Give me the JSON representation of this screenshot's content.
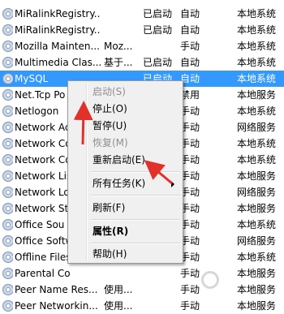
{
  "services": [
    {
      "name": "MiRalinkRegistry...",
      "desc": "",
      "status": "已启动",
      "startup": "自动",
      "logon": "本地系统"
    },
    {
      "name": "MiRalinkRegistry...",
      "desc": "",
      "status": "已启动",
      "startup": "自动",
      "logon": "本地系统"
    },
    {
      "name": "Mozilla Mainten...",
      "desc": "Moz...",
      "status": "",
      "startup": "手动",
      "logon": "本地系统"
    },
    {
      "name": "Multimedia Clas...",
      "desc": "基于...",
      "status": "已启动",
      "startup": "自动",
      "logon": "本地系统"
    },
    {
      "name": "MySQL",
      "desc": "",
      "status": "已启动",
      "startup": "自动",
      "logon": "本地系统"
    },
    {
      "name": "Net.Tcp Po",
      "desc": "",
      "status": "",
      "startup": "禁用",
      "logon": "本地服务"
    },
    {
      "name": "Netlogon",
      "desc": "",
      "status": "",
      "startup": "手动",
      "logon": "本地系统"
    },
    {
      "name": "Network Ac",
      "desc": "",
      "status": "",
      "startup": "手动",
      "logon": "网络服务"
    },
    {
      "name": "Network Co",
      "desc": "",
      "status": "",
      "startup": "手动",
      "logon": "本地系统"
    },
    {
      "name": "Network Co",
      "desc": "",
      "status": "",
      "startup": "手动",
      "logon": "本地系统"
    },
    {
      "name": "Network Lis",
      "desc": "",
      "status": "",
      "startup": "手动",
      "logon": "本地服务"
    },
    {
      "name": "Network Lo",
      "desc": "",
      "status": "",
      "startup": "手动",
      "logon": "网络服务"
    },
    {
      "name": "Network St",
      "desc": "",
      "status": "",
      "startup": "手动",
      "logon": "本地服务"
    },
    {
      "name": "Office Sou",
      "desc": "",
      "status": "",
      "startup": "手动",
      "logon": "本地系统"
    },
    {
      "name": "Office Softw",
      "desc": "",
      "status": "",
      "startup": "手动",
      "logon": "网络服务"
    },
    {
      "name": "Offline Files",
      "desc": "",
      "status": "",
      "startup": "手动",
      "logon": "本地系统"
    },
    {
      "name": "Parental Co",
      "desc": "",
      "status": "",
      "startup": "手动",
      "logon": "本地服务"
    },
    {
      "name": "Peer Name Res...",
      "desc": "使用...",
      "status": "",
      "startup": "手动",
      "logon": "本地服务"
    },
    {
      "name": "Peer Networkin...",
      "desc": "使用...",
      "status": "",
      "startup": "手动",
      "logon": "本地服务"
    }
  ],
  "selected_index": 4,
  "context_menu": {
    "items": [
      {
        "label": "启动(S)",
        "disabled": true
      },
      {
        "label": "停止(O)",
        "disabled": false
      },
      {
        "label": "暂停(U)",
        "disabled": false
      },
      {
        "label": "恢复(M)",
        "disabled": true
      },
      {
        "label": "重新启动(E)",
        "disabled": false
      },
      {
        "label": "所有任务(K)",
        "disabled": false,
        "submenu": true
      },
      {
        "label": "刷新(F)",
        "disabled": false
      },
      {
        "label": "属性(R)",
        "disabled": false,
        "bold": true
      },
      {
        "label": "帮助(H)",
        "disabled": false
      }
    ]
  },
  "colors": {
    "selection": "#3399ff",
    "annotation_arrow": "#e0312b"
  },
  "icons": {
    "service": "service-gear-icon",
    "submenu": "chevron-right-icon"
  }
}
